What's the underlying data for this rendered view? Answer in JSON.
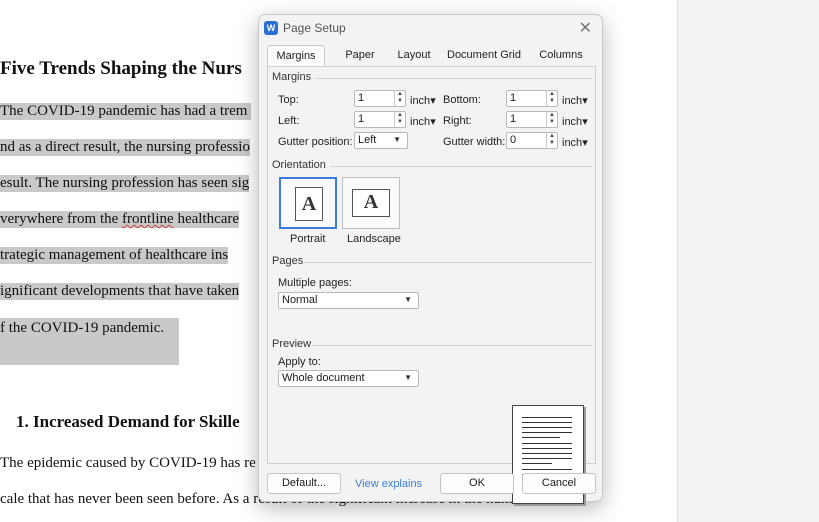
{
  "document": {
    "heading": "Five Trends Shaping the Nurs",
    "lines": [
      "The COVID-19 pandemic has had a trem",
      "nd as a direct result, the nursing professio",
      "esult. The nursing profession has seen sig",
      "verywhere from the ",
      "trategic management of healthcare ins",
      "ignificant developments that have taken ",
      "f the COVID-19 pandemic."
    ],
    "frontline_word": "frontline",
    "line4_tail": " healthcare",
    "subheading": "1.  Increased Demand for Skille",
    "lines_after": [
      "The epidemic caused by COVID-19 has re",
      "cale that has never been seen before. As a result of the significant increase in the number of"
    ]
  },
  "dialog": {
    "app_icon": "W",
    "title": "Page Setup",
    "close_glyph": "✕",
    "tabs": [
      "Margins",
      "Paper",
      "Layout",
      "Document Grid",
      "Columns"
    ],
    "active_tab": "Margins",
    "margins": {
      "section": "Margins",
      "top_label": "Top:",
      "top_value": "1",
      "bottom_label": "Bottom:",
      "bottom_value": "1",
      "left_label": "Left:",
      "left_value": "1",
      "right_label": "Right:",
      "right_value": "1",
      "gutter_position_label": "Gutter position:",
      "gutter_position_value": "Left",
      "gutter_width_label": "Gutter width:",
      "gutter_width_value": "0",
      "unit": "inch"
    },
    "orientation": {
      "section": "Orientation",
      "portrait": "Portrait",
      "landscape": "Landscape",
      "glyph": "A",
      "selected": "Portrait"
    },
    "pages": {
      "section": "Pages",
      "multiple_label": "Multiple pages:",
      "multiple_value": "Normal"
    },
    "preview": {
      "section": "Preview",
      "apply_label": "Apply to:",
      "apply_value": "Whole document"
    },
    "buttons": {
      "default": "Default...",
      "view_explains": "View explains",
      "ok": "OK",
      "cancel": "Cancel"
    }
  },
  "colors": {
    "accent": "#3c7bd9",
    "selection": "#c9c9c9",
    "link": "#3d7fd6"
  }
}
